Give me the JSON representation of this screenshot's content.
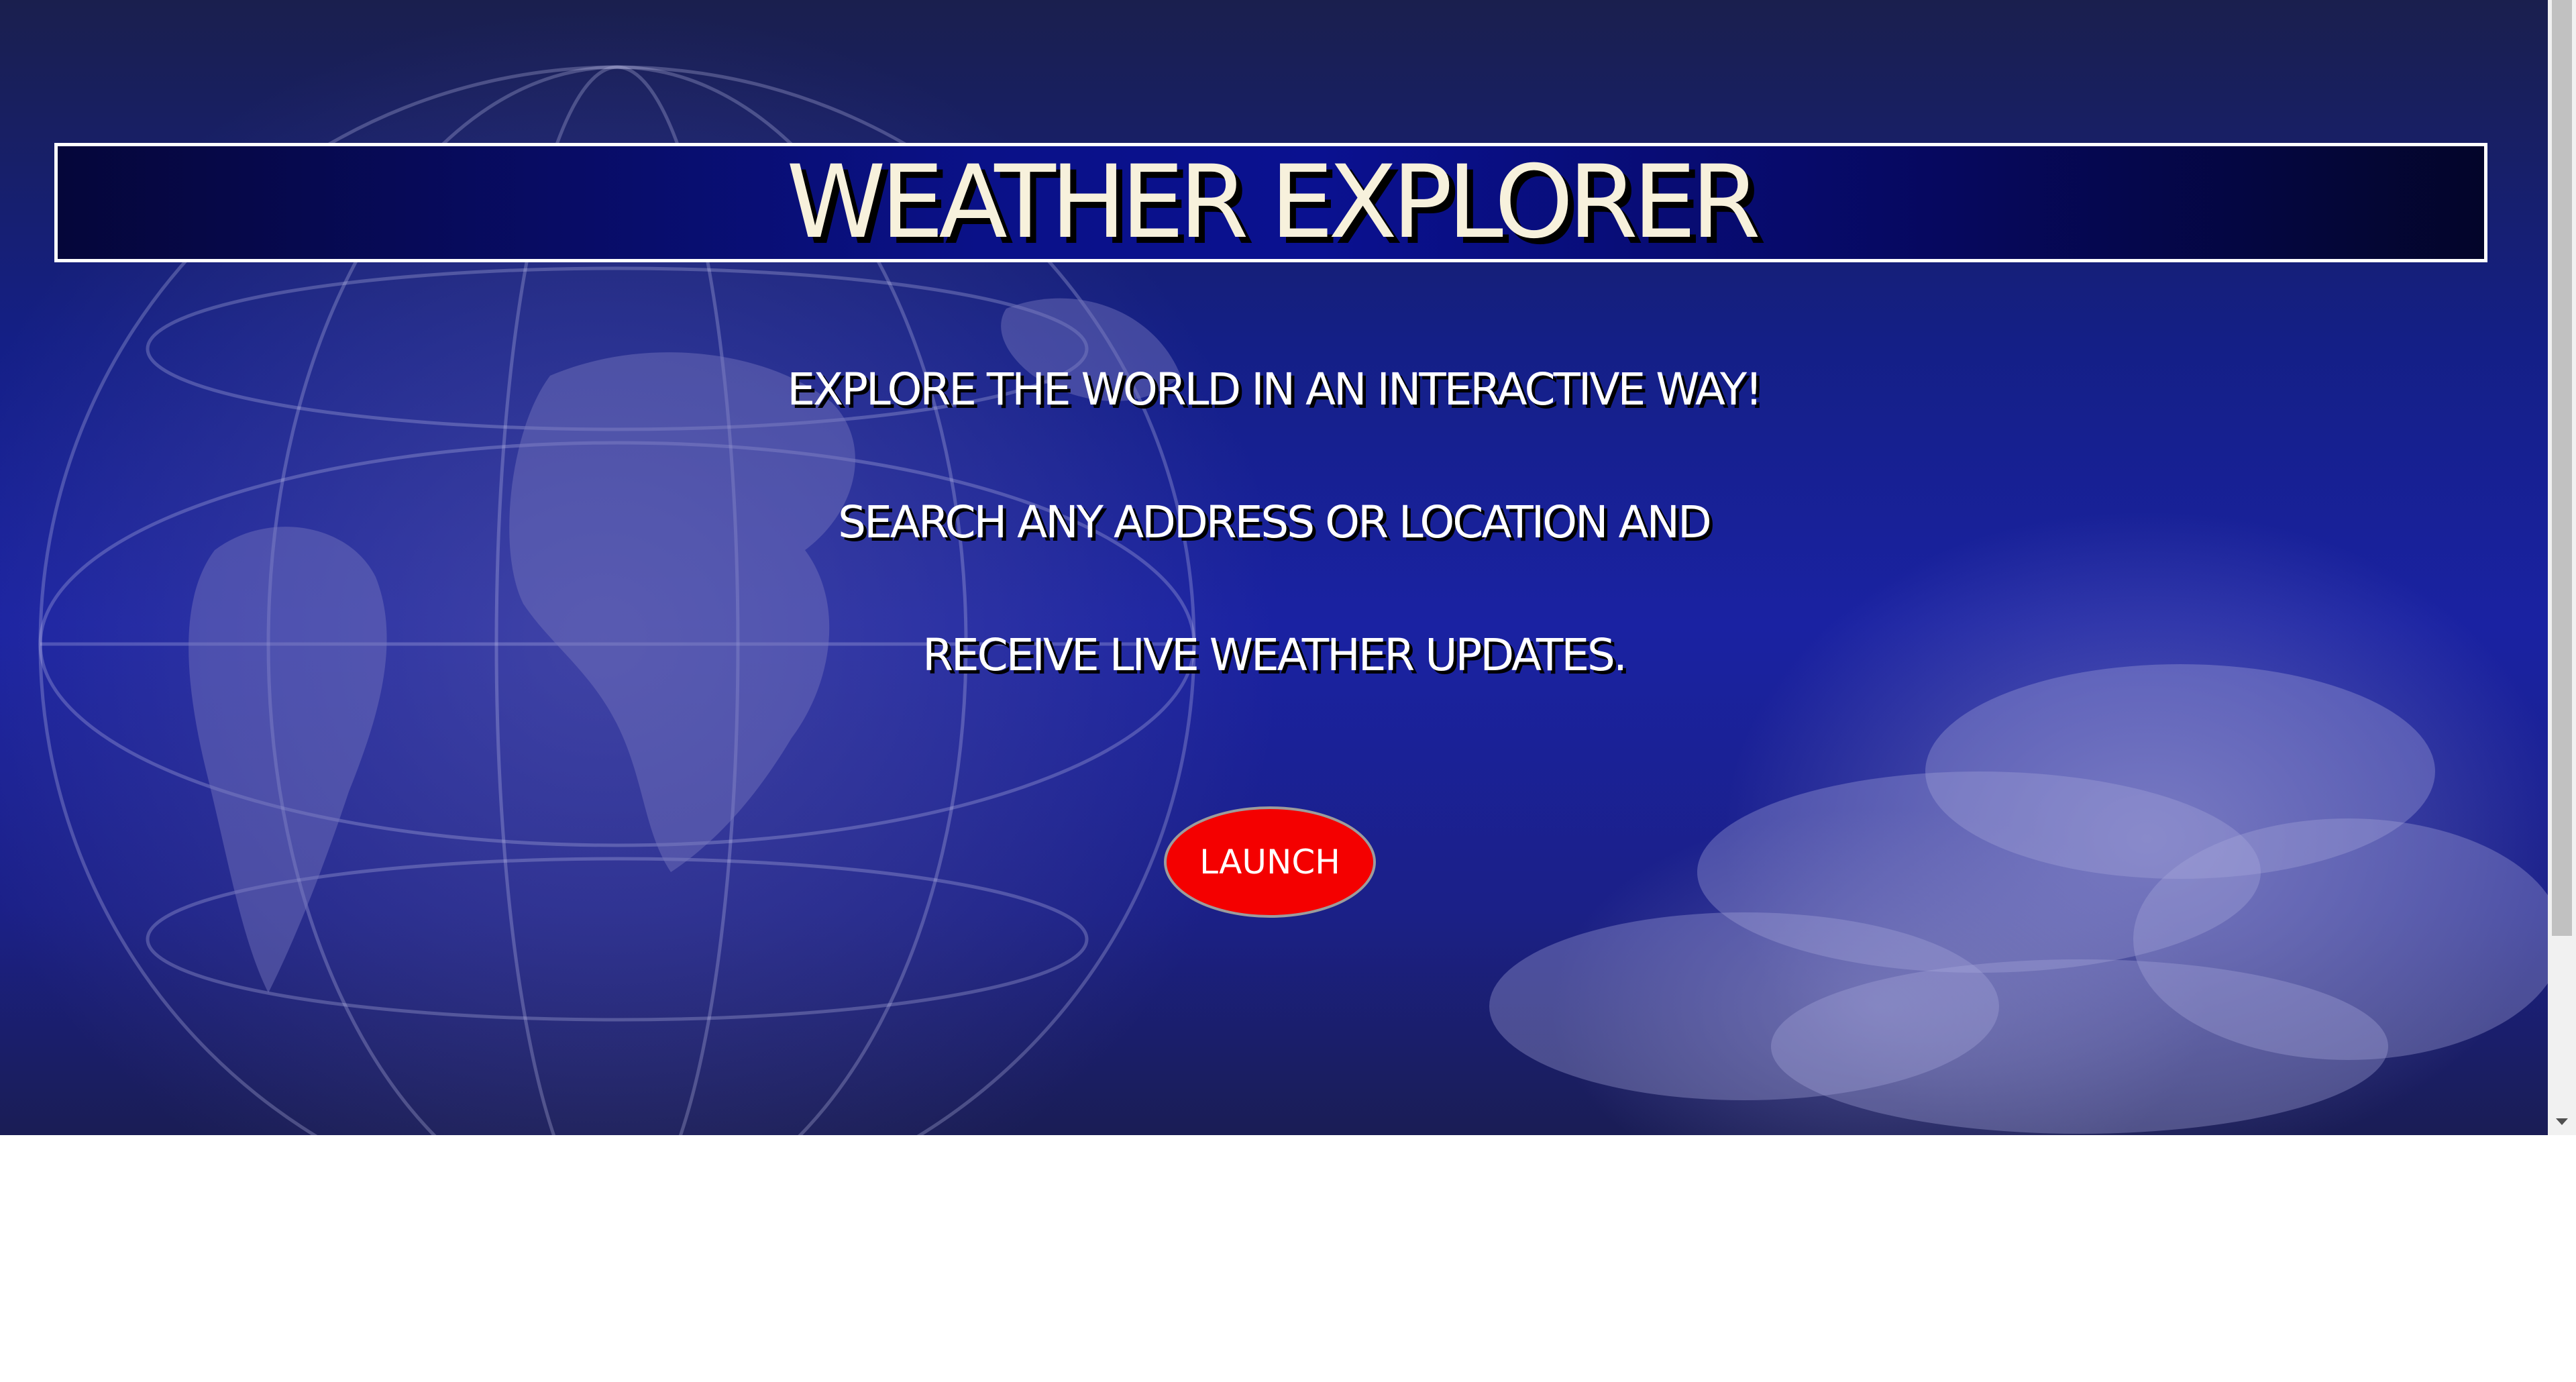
{
  "hero": {
    "title": "WEATHER EXPLORER",
    "lines": [
      "EXPLORE THE WORLD IN AN INTERACTIVE WAY!",
      "SEARCH ANY ADDRESS OR LOCATION AND",
      "RECEIVE LIVE WEATHER UPDATES."
    ],
    "launch_label": "LAUNCH"
  },
  "icons": {
    "scroll_down": "chevron-down-icon",
    "background": "globe-icon"
  },
  "colors": {
    "background_primary": "#1a22a2",
    "title_text": "#f7f1dc",
    "launch_button": "#f40000",
    "page_below": "#ffffff"
  }
}
